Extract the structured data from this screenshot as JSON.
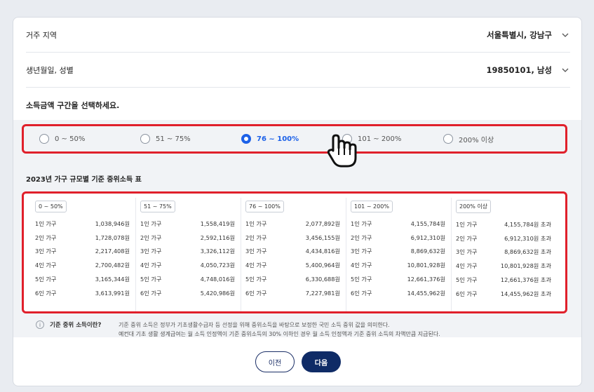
{
  "residence": {
    "label": "거주 지역",
    "value": "서울특별시, 강남구"
  },
  "birth": {
    "label": "생년월일, 성별",
    "value": "19850101, 남성"
  },
  "income_prompt": "소득금액 구간을 선택하세요.",
  "income_options": [
    {
      "label": "0 ~ 50%",
      "selected": false
    },
    {
      "label": "51 ~ 75%",
      "selected": false
    },
    {
      "label": "76 ~ 100%",
      "selected": true
    },
    {
      "label": "101 ~ 200%",
      "selected": false
    },
    {
      "label": "200% 이상",
      "selected": false
    }
  ],
  "table_title": "2023년 가구 규모별 기준 중위소득 표",
  "tables": [
    {
      "header": "0 ~ 50%",
      "rows": [
        {
          "household": "1인 가구",
          "amount": "1,038,946원"
        },
        {
          "household": "2인 가구",
          "amount": "1,728,078원"
        },
        {
          "household": "3인 가구",
          "amount": "2,217,408원"
        },
        {
          "household": "4인 가구",
          "amount": "2,700,482원"
        },
        {
          "household": "5인 가구",
          "amount": "3,165,344원"
        },
        {
          "household": "6인 가구",
          "amount": "3,613,991원"
        }
      ]
    },
    {
      "header": "51 ~ 75%",
      "rows": [
        {
          "household": "1인 가구",
          "amount": "1,558,419원"
        },
        {
          "household": "2인 가구",
          "amount": "2,592,116원"
        },
        {
          "household": "3인 가구",
          "amount": "3,326,112원"
        },
        {
          "household": "4인 가구",
          "amount": "4,050,723원"
        },
        {
          "household": "5인 가구",
          "amount": "4,748,016원"
        },
        {
          "household": "6인 가구",
          "amount": "5,420,986원"
        }
      ]
    },
    {
      "header": "76 ~ 100%",
      "rows": [
        {
          "household": "1인 가구",
          "amount": "2,077,892원"
        },
        {
          "household": "2인 가구",
          "amount": "3,456,155원"
        },
        {
          "household": "3인 가구",
          "amount": "4,434,816원"
        },
        {
          "household": "4인 가구",
          "amount": "5,400,964원"
        },
        {
          "household": "5인 가구",
          "amount": "6,330,688원"
        },
        {
          "household": "6인 가구",
          "amount": "7,227,981원"
        }
      ]
    },
    {
      "header": "101 ~ 200%",
      "rows": [
        {
          "household": "1인 가구",
          "amount": "4,155,784원"
        },
        {
          "household": "2인 가구",
          "amount": "6,912,310원"
        },
        {
          "household": "3인 가구",
          "amount": "8,869,632원"
        },
        {
          "household": "4인 가구",
          "amount": "10,801,928원"
        },
        {
          "household": "5인 가구",
          "amount": "12,661,376원"
        },
        {
          "household": "6인 가구",
          "amount": "14,455,962원"
        }
      ]
    },
    {
      "header": "200% 이상",
      "rows": [
        {
          "household": "1인 가구",
          "amount": "4,155,784원 초과"
        },
        {
          "household": "2인 가구",
          "amount": "6,912,310원 초과"
        },
        {
          "household": "3인 가구",
          "amount": "8,869,632원 초과"
        },
        {
          "household": "4인 가구",
          "amount": "10,801,928원 초과"
        },
        {
          "household": "5인 가구",
          "amount": "12,661,376원 초과"
        },
        {
          "household": "6인 가구",
          "amount": "14,455,962원 초과"
        }
      ]
    }
  ],
  "note": {
    "title": "기준 중위 소득이란?",
    "line1": "기준 중위 소득은 정부가 기초생활수급자 등 선정을 위해 중위소득을 바탕으로 보정한 국민 소득 중위 값을 의미한다.",
    "line2": "예컨대 기초 생활 생계급여는 월 소득 인정액이 기준 중위소득의 30% 이하인 경우 월 소득 인정액과 기준 중위 소득의 차액만큼 지급된다."
  },
  "buttons": {
    "prev": "이전",
    "next": "다음"
  },
  "colors": {
    "accent": "#1c61e8",
    "highlight": "#e0202b",
    "primary_button": "#0f2b66"
  },
  "icons": [
    "chevron-down-icon",
    "info-icon",
    "hand-pointer-icon"
  ]
}
